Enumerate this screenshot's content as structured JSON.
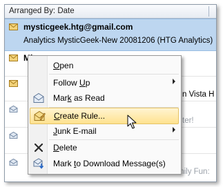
{
  "list": {
    "header_label": "Arranged By: Date",
    "selected": {
      "sender": "mysticgeek.htg@gmail.com",
      "subject": "Analytics MysticGeek-New 20081206 (HTG Analytics)"
    },
    "partial_sender": "Mi",
    "fragments": {
      "vista": "n Vista H",
      "ter": "ter!",
      "fun": "mily Fun:"
    }
  },
  "context_menu": {
    "items": [
      {
        "name": "open",
        "accel": "O",
        "rest": "pen"
      },
      {
        "name": "follow_up_a",
        "pre": "Follow ",
        "accel": "U",
        "rest": "p"
      },
      {
        "name": "mark_read",
        "pre": "Mar",
        "accel": "k",
        "rest": " as Read"
      },
      {
        "name": "create_rule",
        "accel": "C",
        "rest": "reate Rule..."
      },
      {
        "name": "junk",
        "accel": "J",
        "rest": "unk E-mail"
      },
      {
        "name": "delete",
        "accel": "D",
        "rest": "elete"
      },
      {
        "name": "mark_download",
        "pre": "Mark ",
        "accel": "t",
        "rest": "o Download Message(s)"
      }
    ]
  },
  "colors": {
    "selection": "#bdd6f0",
    "highlight": "#ffe28f",
    "envelope": "#f2d27a"
  }
}
